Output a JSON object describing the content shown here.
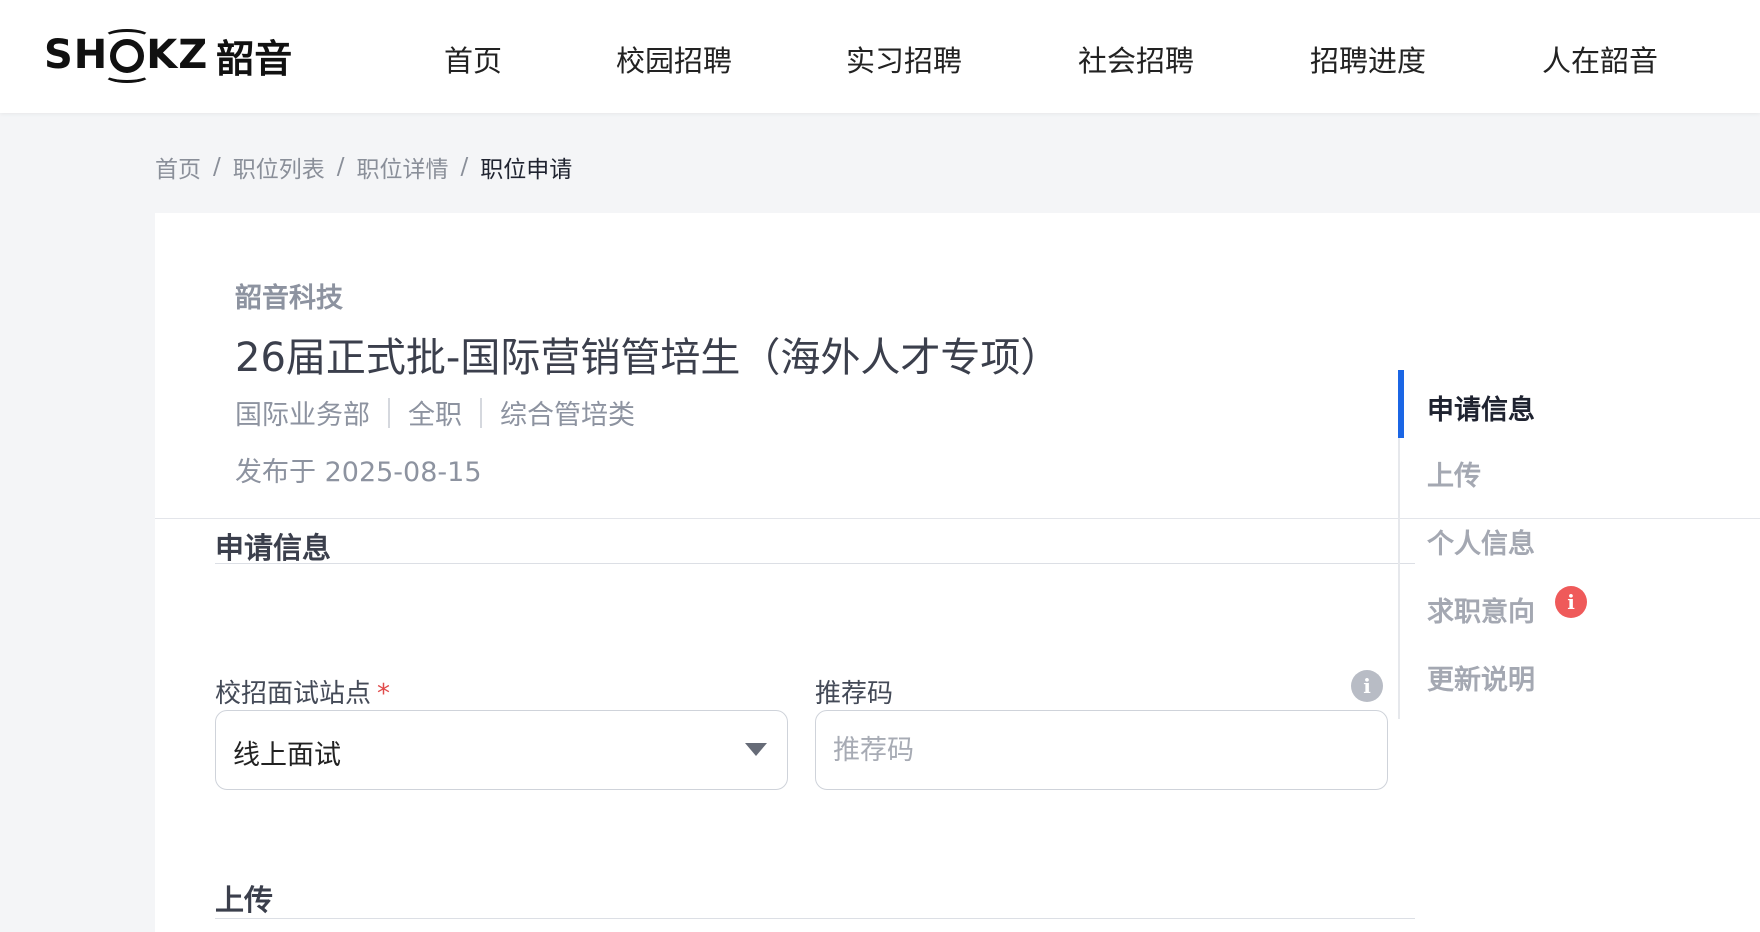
{
  "header": {
    "logo_text": "SH",
    "logo_text_end": "KZ",
    "logo_cn": "韶音",
    "nav": [
      "首页",
      "校园招聘",
      "实习招聘",
      "社会招聘",
      "招聘进度",
      "人在韶音"
    ]
  },
  "breadcrumb": [
    "首页",
    "职位列表",
    "职位详情",
    "职位申请"
  ],
  "breadcrumb_sep": "/",
  "job": {
    "company": "韶音科技",
    "title": "26届正式批-国际营销管培生（海外人才专项）",
    "meta": [
      "国际业务部",
      "全职",
      "综合管培类"
    ],
    "posted": "发布于 2025-08-15"
  },
  "form": {
    "section_apply": "申请信息",
    "site_label": "校招面试站点",
    "required_mark": "*",
    "site_value": "线上面试",
    "referral_label": "推荐码",
    "referral_placeholder": "推荐码",
    "info_glyph": "i",
    "section_upload": "上传"
  },
  "side_nav": {
    "items": [
      "申请信息",
      "上传",
      "个人信息",
      "求职意向",
      "更新说明"
    ],
    "warn_glyph": "i"
  },
  "colors": {
    "accent": "#1b66e5",
    "warning": "#ef5a5a"
  }
}
